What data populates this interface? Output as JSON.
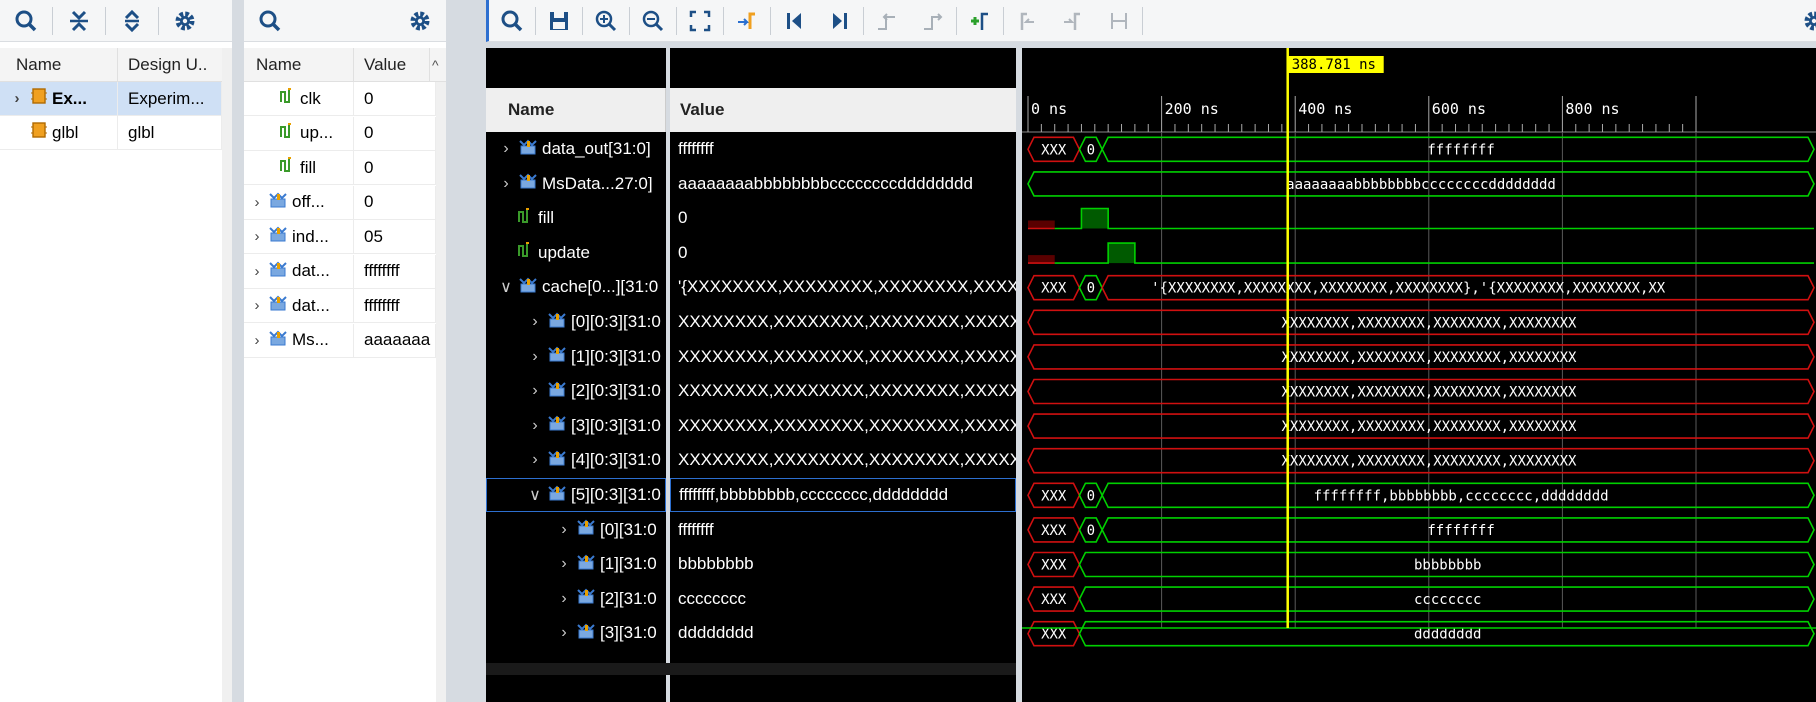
{
  "scopes_panel": {
    "toolbar": [
      "search-icon",
      "collapse-all-icon",
      "expand-all-icon",
      "gear-icon"
    ],
    "columns": [
      "Name",
      "Design U.."
    ],
    "rows": [
      {
        "name": "Ex...",
        "design": "Experim...",
        "expanded": false,
        "selected": true
      },
      {
        "name": "glbl",
        "design": "glbl",
        "expanded": false,
        "selected": false
      }
    ]
  },
  "objects_panel": {
    "toolbar": [
      "search-icon",
      "gear-icon"
    ],
    "columns": [
      "Name",
      "Value"
    ],
    "sort_indicator": "^",
    "rows": [
      {
        "name": "clk",
        "value": "0",
        "icon": "signal"
      },
      {
        "name": "up...",
        "value": "0",
        "icon": "signal"
      },
      {
        "name": "fill",
        "value": "0",
        "icon": "signal"
      },
      {
        "name": "off...",
        "value": "0",
        "icon": "bus"
      },
      {
        "name": "ind...",
        "value": "05",
        "icon": "bus"
      },
      {
        "name": "dat...",
        "value": "ffffffff",
        "icon": "bus"
      },
      {
        "name": "dat...",
        "value": "ffffffff",
        "icon": "bus"
      },
      {
        "name": "Ms...",
        "value": "aaaaaaa",
        "icon": "bus"
      }
    ]
  },
  "wave_toolbar": [
    "search-icon",
    "save-icon",
    "zoom-in-icon",
    "zoom-out-icon",
    "zoom-fit-icon",
    "go-to-cursor-icon",
    "go-to-start-icon",
    "go-to-end-icon",
    "previous-transition-icon",
    "next-transition-icon",
    "add-marker-icon",
    "previous-marker-icon",
    "next-marker-icon",
    "swap-cursors-icon",
    "gear-icon"
  ],
  "wave": {
    "columns": {
      "name": "Name",
      "value": "Value"
    },
    "cursor_label": "388.781 ns",
    "time_ticks": [
      "0 ns",
      "200 ns",
      "400 ns",
      "600 ns",
      "800 ns"
    ],
    "signals": [
      {
        "name": "data_out[31:0]",
        "value": "ffffffff",
        "indent": 0,
        "expander": ">",
        "kind": "bus",
        "wave_text": "ffffffff",
        "wave": "bus_x_then"
      },
      {
        "name": "MsData...27:0]",
        "value": "aaaaaaaabbbbbbbbccccccccdddddddd",
        "indent": 0,
        "expander": ">",
        "kind": "bus",
        "wave_text": "aaaaaaaabbbbbbbbccccccccdddddddd",
        "wave": "bus_full"
      },
      {
        "name": "fill",
        "value": "0",
        "indent": 0,
        "expander": "",
        "kind": "bit",
        "wave": "fill"
      },
      {
        "name": "update",
        "value": "0",
        "indent": 0,
        "expander": "",
        "kind": "bit",
        "wave": "update"
      },
      {
        "name": "cache[0...][31:0",
        "value": "'{XXXXXXXX,XXXXXXXX,XXXXXXXX,XXXXXXXX",
        "indent": 0,
        "expander": "v",
        "kind": "bus",
        "wave_text": "'{XXXXXXXX,XXXXXXXX,XXXXXXXX,XXXXXXXX},'{XXXXXXXX,XXXXXXXX,XX",
        "wave": "bus_x_then_red"
      },
      {
        "name": "[0][0:3][31:0",
        "value": "XXXXXXXX,XXXXXXXX,XXXXXXXX,XXXXXXXX",
        "indent": 1,
        "expander": ">",
        "kind": "bus",
        "wave_text": "XXXXXXXX,XXXXXXXX,XXXXXXXX,XXXXXXXX",
        "wave": "bus_red"
      },
      {
        "name": "[1][0:3][31:0",
        "value": "XXXXXXXX,XXXXXXXX,XXXXXXXX,XXXXXXXX",
        "indent": 1,
        "expander": ">",
        "kind": "bus",
        "wave_text": "XXXXXXXX,XXXXXXXX,XXXXXXXX,XXXXXXXX",
        "wave": "bus_red"
      },
      {
        "name": "[2][0:3][31:0",
        "value": "XXXXXXXX,XXXXXXXX,XXXXXXXX,XXXXXXXX",
        "indent": 1,
        "expander": ">",
        "kind": "bus",
        "wave_text": "XXXXXXXX,XXXXXXXX,XXXXXXXX,XXXXXXXX",
        "wave": "bus_red"
      },
      {
        "name": "[3][0:3][31:0",
        "value": "XXXXXXXX,XXXXXXXX,XXXXXXXX,XXXXXXXX",
        "indent": 1,
        "expander": ">",
        "kind": "bus",
        "wave_text": "XXXXXXXX,XXXXXXXX,XXXXXXXX,XXXXXXXX",
        "wave": "bus_red"
      },
      {
        "name": "[4][0:3][31:0",
        "value": "XXXXXXXX,XXXXXXXX,XXXXXXXX,XXXXXXXX",
        "indent": 1,
        "expander": ">",
        "kind": "bus",
        "wave_text": "XXXXXXXX,XXXXXXXX,XXXXXXXX,XXXXXXXX",
        "wave": "bus_red"
      },
      {
        "name": "[5][0:3][31:0",
        "value": "ffffffff,bbbbbbbb,cccccccc,dddddddd",
        "indent": 1,
        "expander": "v",
        "kind": "bus",
        "wave_text": "ffffffff,bbbbbbbb,cccccccc,dddddddd",
        "wave": "bus_x_then",
        "selected": true
      },
      {
        "name": "[0][31:0",
        "value": "ffffffff",
        "indent": 2,
        "expander": ">",
        "kind": "bus",
        "wave_text": "ffffffff",
        "wave": "bus_x_then"
      },
      {
        "name": "[1][31:0",
        "value": "bbbbbbbb",
        "indent": 2,
        "expander": ">",
        "kind": "bus",
        "wave_text": "bbbbbbbb",
        "wave": "bus_x_short"
      },
      {
        "name": "[2][31:0",
        "value": "cccccccc",
        "indent": 2,
        "expander": ">",
        "kind": "bus",
        "wave_text": "cccccccc",
        "wave": "bus_x_short"
      },
      {
        "name": "[3][31:0",
        "value": "dddddddd",
        "indent": 2,
        "expander": ">",
        "kind": "bus",
        "wave_text": "dddddddd",
        "wave": "bus_x_short"
      }
    ],
    "x_marker_text": "XXX",
    "zero_marker_text": "0",
    "colors": {
      "green": "#00d000",
      "red": "#d01010",
      "cursor": "#ffff00",
      "grid": "#5a5a5a",
      "bg": "#000000"
    }
  }
}
